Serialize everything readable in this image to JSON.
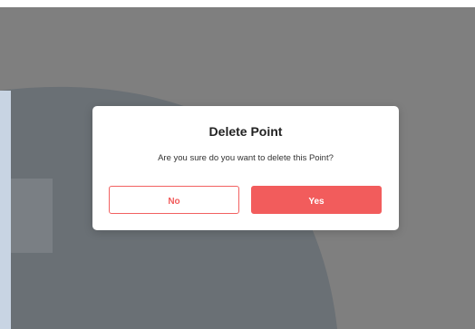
{
  "dialog": {
    "title": "Delete Point",
    "message": "Are you sure do you want to delete this Point?",
    "no_label": "No",
    "yes_label": "Yes"
  },
  "colors": {
    "backdrop": "#7f7f7f",
    "dark_shape": "#6a7075",
    "light_accent": "#c8d4e3",
    "accent": "#f25c5c",
    "dialog_bg": "#ffffff"
  }
}
